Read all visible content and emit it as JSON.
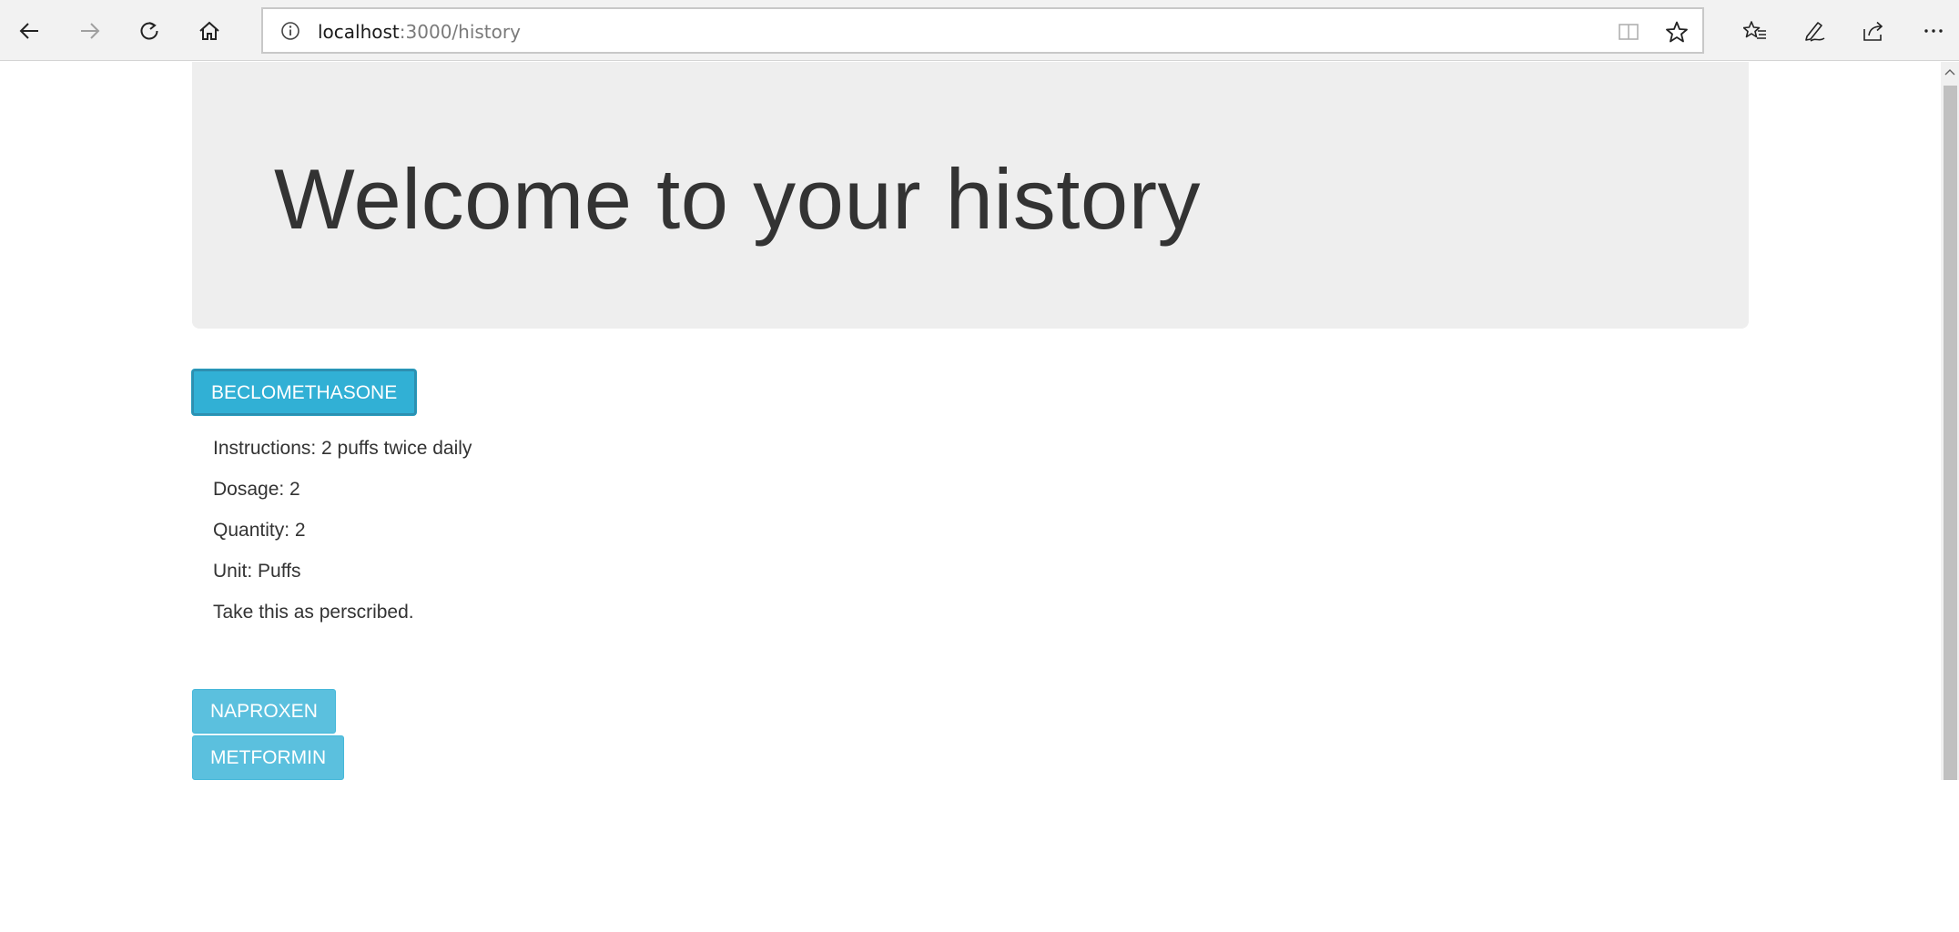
{
  "browser": {
    "url_host": "localhost",
    "url_path": ":3000/history",
    "icons": {
      "back": "back-arrow-icon",
      "forward": "forward-arrow-icon",
      "refresh": "refresh-icon",
      "home": "home-icon",
      "site_info": "info-icon",
      "reading_view": "reading-view-icon",
      "favorite": "star-icon",
      "favorites_list": "favorites-list-icon",
      "notes": "pen-icon",
      "share": "share-icon",
      "more": "more-icon"
    }
  },
  "page": {
    "heading": "Welcome to your history",
    "medications": [
      {
        "label": "BECLOMETHASONE",
        "expanded": true
      },
      {
        "label": "NAPROXEN",
        "expanded": false
      },
      {
        "label": "METFORMIN",
        "expanded": false
      }
    ],
    "details": {
      "instructions": "Instructions: 2 puffs twice daily",
      "dosage": "Dosage: 2",
      "quantity": "Quantity: 2",
      "unit": "Unit: Puffs",
      "note": "Take this as perscribed."
    }
  },
  "colors": {
    "button": "#5bc0de",
    "button_active": "#31b0d5",
    "jumbotron": "#eeeeee",
    "text": "#333333"
  }
}
